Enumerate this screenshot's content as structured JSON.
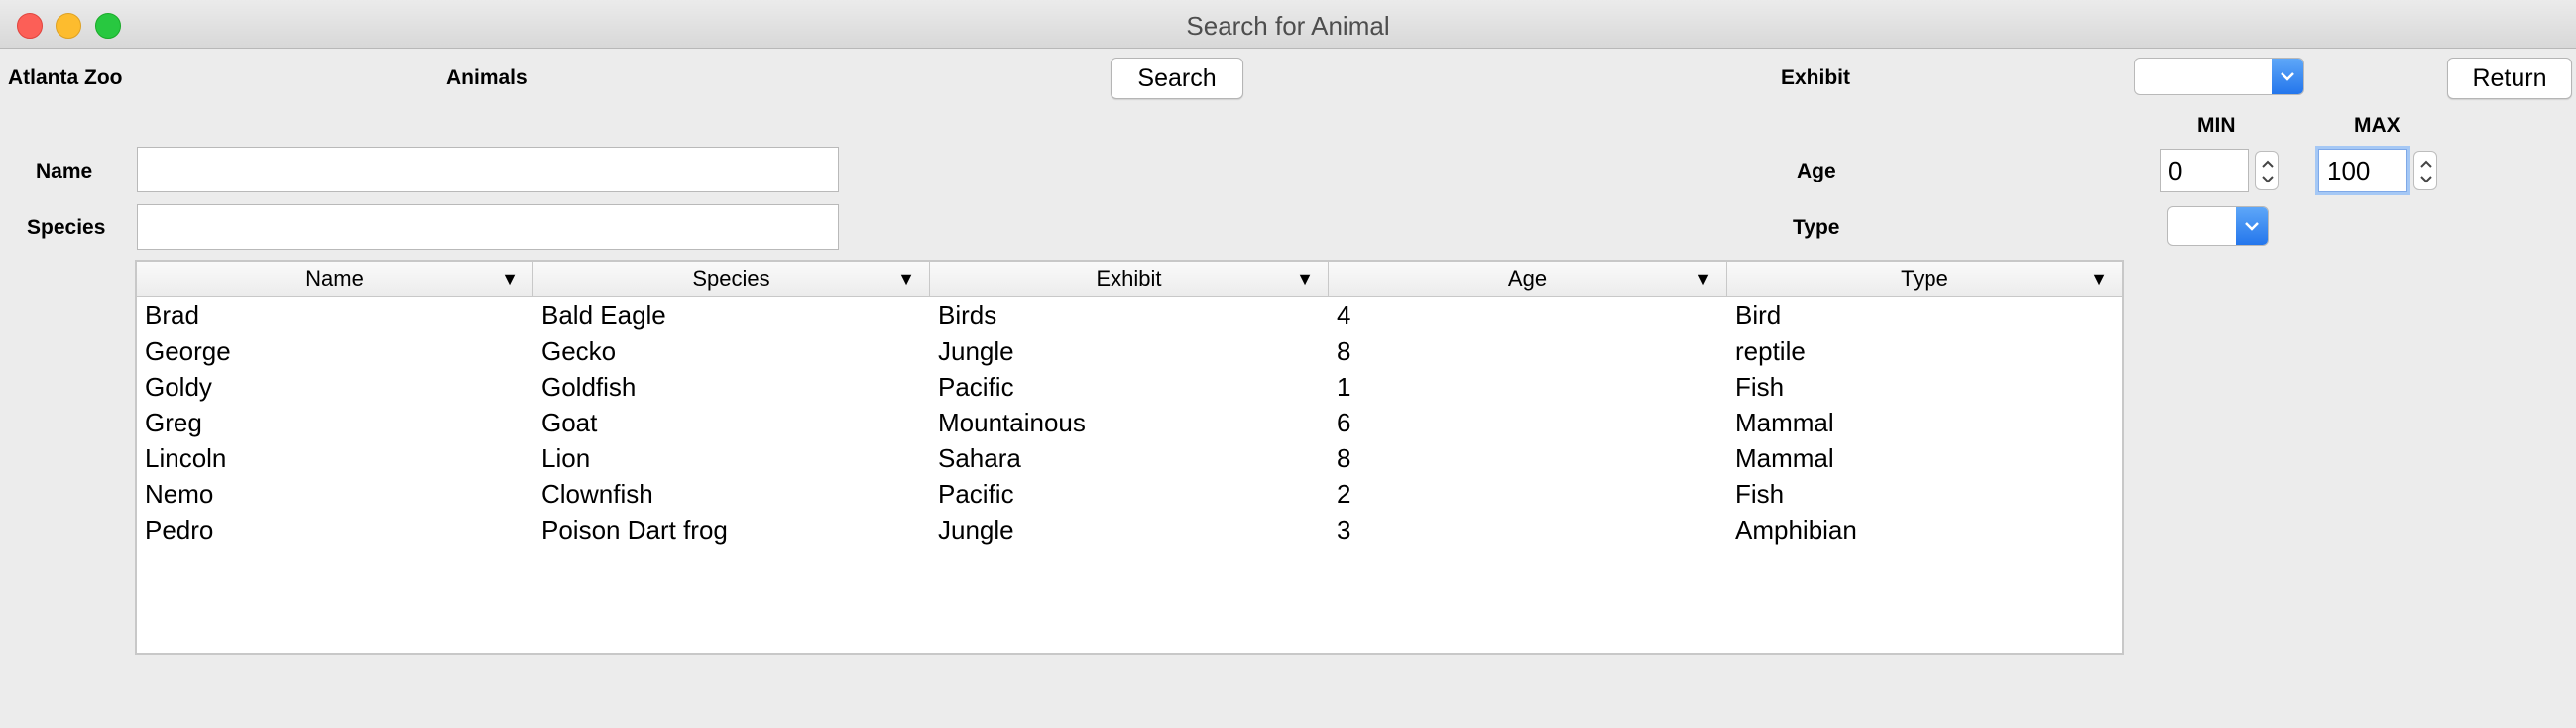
{
  "window": {
    "title": "Search for Animal"
  },
  "labels": {
    "app": "Atlanta Zoo",
    "animals": "Animals",
    "exhibit": "Exhibit",
    "name": "Name",
    "species": "Species",
    "age": "Age",
    "type": "Type",
    "min": "MIN",
    "max": "MAX"
  },
  "buttons": {
    "search": "Search",
    "return": "Return"
  },
  "inputs": {
    "name_value": "",
    "species_value": "",
    "age_min": "0",
    "age_max": "100",
    "exhibit_selected": "",
    "type_selected": ""
  },
  "table": {
    "columns": [
      "Name",
      "Species",
      "Exhibit",
      "Age",
      "Type"
    ],
    "rows": [
      [
        "Brad",
        "Bald Eagle",
        "Birds",
        "4",
        "Bird"
      ],
      [
        "George",
        "Gecko",
        "Jungle",
        "8",
        "reptile"
      ],
      [
        "Goldy",
        "Goldfish",
        "Pacific",
        "1",
        "Fish"
      ],
      [
        "Greg",
        "Goat",
        "Mountainous",
        "6",
        "Mammal"
      ],
      [
        "Lincoln",
        "Lion",
        "Sahara",
        "8",
        "Mammal"
      ],
      [
        "Nemo",
        "Clownfish",
        "Pacific",
        "2",
        "Fish"
      ],
      [
        "Pedro",
        "Poison Dart frog",
        "Jungle",
        "3",
        "Amphibian"
      ]
    ]
  },
  "colors": {
    "accent": "#2476ec",
    "focus_ring": "#a5c8f5"
  }
}
